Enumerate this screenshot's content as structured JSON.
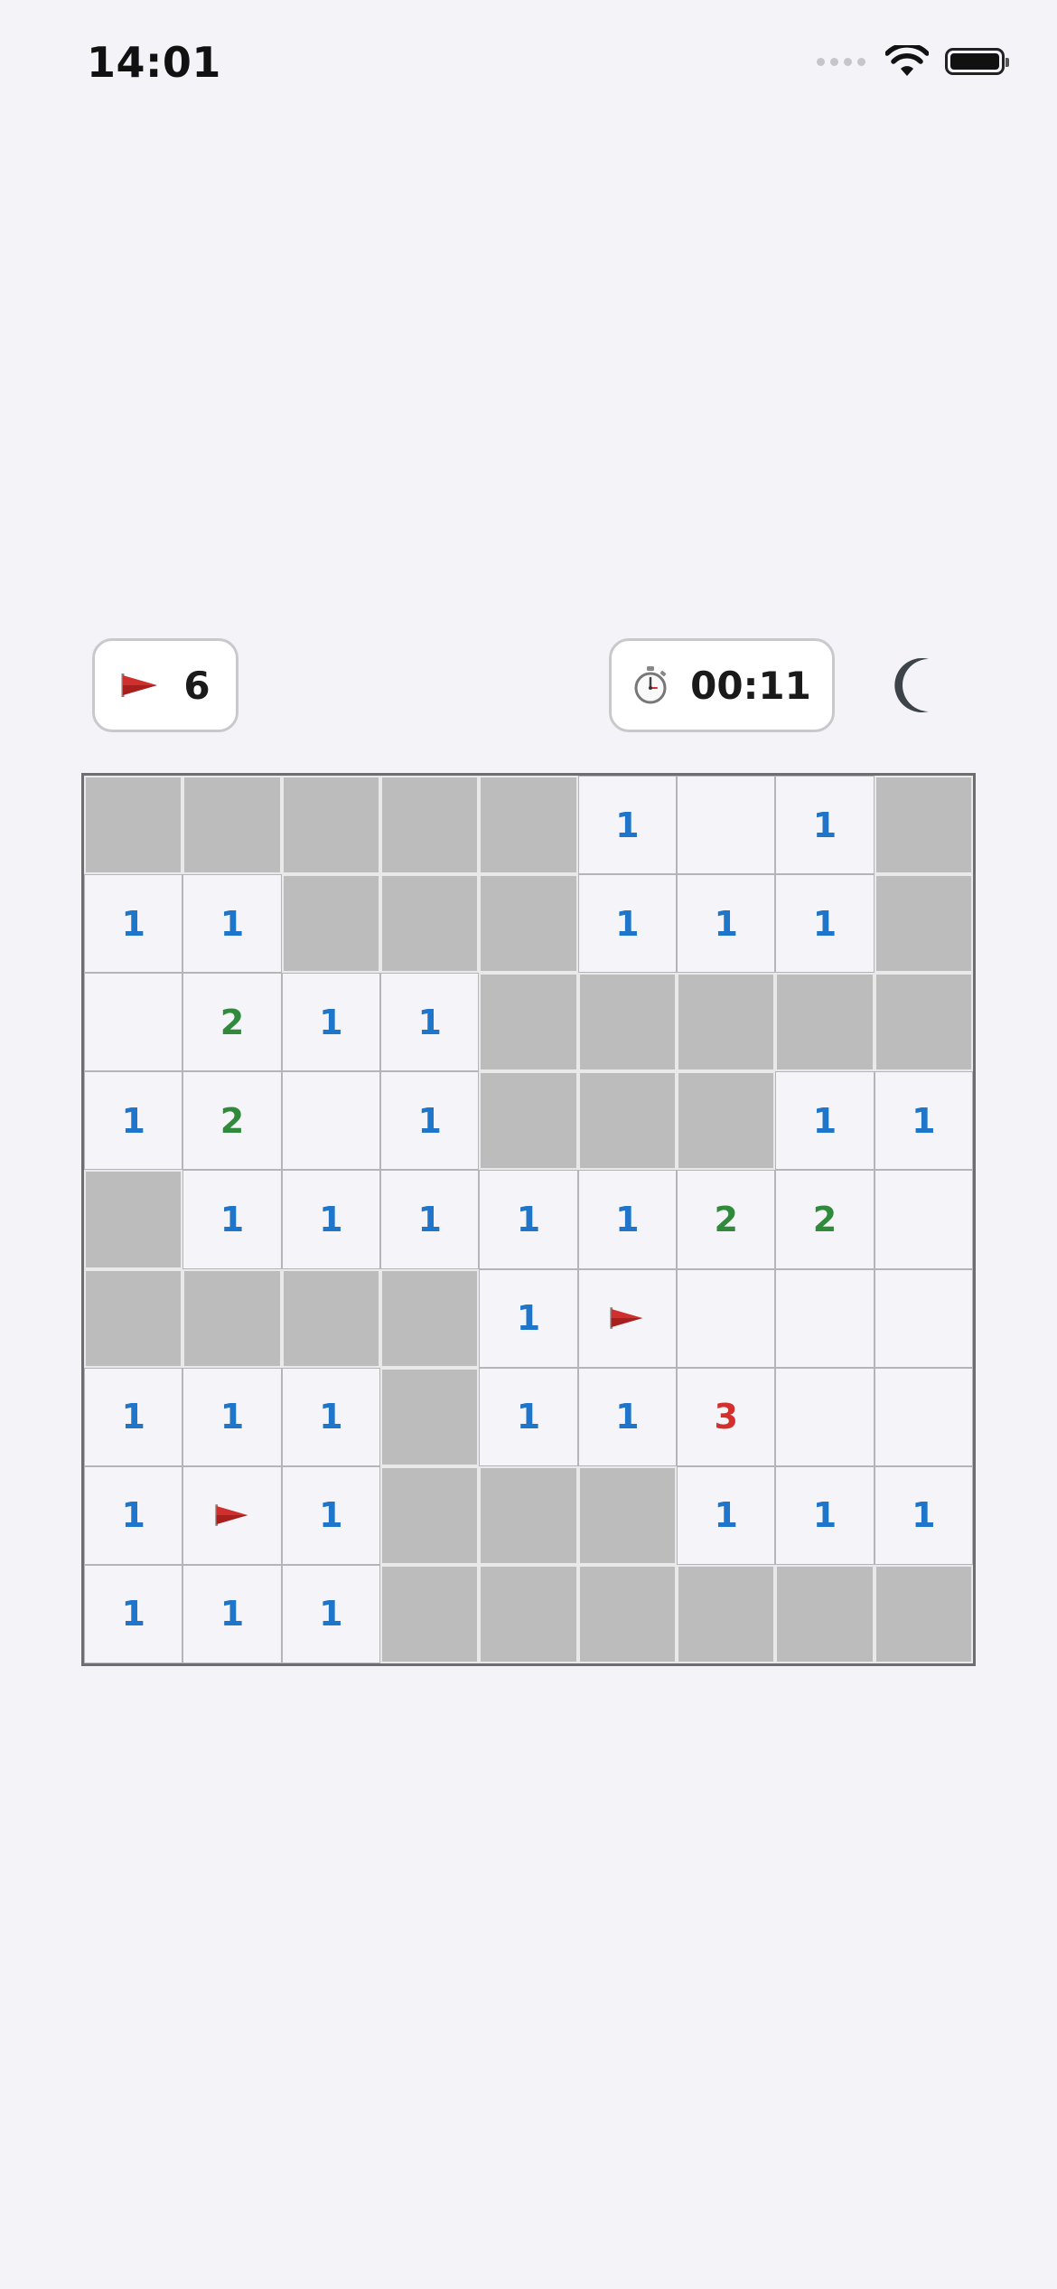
{
  "status_bar": {
    "time": "14:01"
  },
  "toolbar": {
    "flags_remaining": "6",
    "timer": "00:11",
    "flag_icon": "red-flag-icon",
    "timer_icon": "stopwatch-icon",
    "theme_icon": "moon-icon"
  },
  "colors": {
    "background": "#f4f3f7",
    "hidden_cell": "#bcbcbc",
    "revealed_cell": "#f5f4f8",
    "number_1": "#1f75c9",
    "number_2": "#2f8a3c",
    "number_3": "#d3302d",
    "flag": "#d0302d"
  },
  "board": {
    "rows": 9,
    "cols": 9,
    "legend": {
      "#": "hidden cell",
      "F": "flagged cell",
      "": "revealed empty cell",
      "1-8": "revealed number cell"
    },
    "cells": [
      [
        "#",
        "#",
        "#",
        "#",
        "#",
        "1",
        "",
        "1",
        "#"
      ],
      [
        "1",
        "1",
        "#",
        "#",
        "#",
        "1",
        "1",
        "1",
        "#"
      ],
      [
        "",
        "2",
        "1",
        "1",
        "#",
        "#",
        "#",
        "#",
        "#"
      ],
      [
        "1",
        "2",
        "",
        "1",
        "#",
        "#",
        "#",
        "1",
        "1"
      ],
      [
        "#",
        "1",
        "1",
        "1",
        "1",
        "1",
        "2",
        "2",
        ""
      ],
      [
        "#",
        "#",
        "#",
        "#",
        "1",
        "F",
        "",
        "",
        ""
      ],
      [
        "1",
        "1",
        "1",
        "#",
        "1",
        "1",
        "3",
        "",
        ""
      ],
      [
        "1",
        "F",
        "1",
        "#",
        "#",
        "#",
        "1",
        "1",
        "1"
      ],
      [
        "1",
        "1",
        "1",
        "#",
        "#",
        "#",
        "#",
        "#",
        "#"
      ]
    ]
  }
}
